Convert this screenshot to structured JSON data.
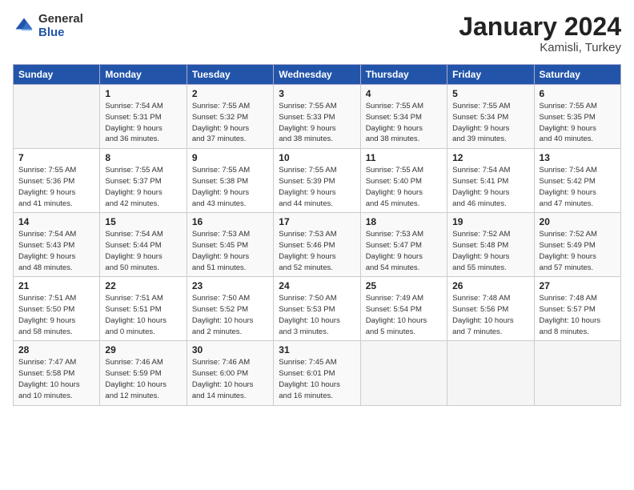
{
  "logo": {
    "general": "General",
    "blue": "Blue"
  },
  "header": {
    "month": "January 2024",
    "location": "Kamisli, Turkey"
  },
  "weekdays": [
    "Sunday",
    "Monday",
    "Tuesday",
    "Wednesday",
    "Thursday",
    "Friday",
    "Saturday"
  ],
  "weeks": [
    [
      {
        "day": "",
        "info": ""
      },
      {
        "day": "1",
        "info": "Sunrise: 7:54 AM\nSunset: 5:31 PM\nDaylight: 9 hours\nand 36 minutes."
      },
      {
        "day": "2",
        "info": "Sunrise: 7:55 AM\nSunset: 5:32 PM\nDaylight: 9 hours\nand 37 minutes."
      },
      {
        "day": "3",
        "info": "Sunrise: 7:55 AM\nSunset: 5:33 PM\nDaylight: 9 hours\nand 38 minutes."
      },
      {
        "day": "4",
        "info": "Sunrise: 7:55 AM\nSunset: 5:34 PM\nDaylight: 9 hours\nand 38 minutes."
      },
      {
        "day": "5",
        "info": "Sunrise: 7:55 AM\nSunset: 5:34 PM\nDaylight: 9 hours\nand 39 minutes."
      },
      {
        "day": "6",
        "info": "Sunrise: 7:55 AM\nSunset: 5:35 PM\nDaylight: 9 hours\nand 40 minutes."
      }
    ],
    [
      {
        "day": "7",
        "info": "Sunrise: 7:55 AM\nSunset: 5:36 PM\nDaylight: 9 hours\nand 41 minutes."
      },
      {
        "day": "8",
        "info": "Sunrise: 7:55 AM\nSunset: 5:37 PM\nDaylight: 9 hours\nand 42 minutes."
      },
      {
        "day": "9",
        "info": "Sunrise: 7:55 AM\nSunset: 5:38 PM\nDaylight: 9 hours\nand 43 minutes."
      },
      {
        "day": "10",
        "info": "Sunrise: 7:55 AM\nSunset: 5:39 PM\nDaylight: 9 hours\nand 44 minutes."
      },
      {
        "day": "11",
        "info": "Sunrise: 7:55 AM\nSunset: 5:40 PM\nDaylight: 9 hours\nand 45 minutes."
      },
      {
        "day": "12",
        "info": "Sunrise: 7:54 AM\nSunset: 5:41 PM\nDaylight: 9 hours\nand 46 minutes."
      },
      {
        "day": "13",
        "info": "Sunrise: 7:54 AM\nSunset: 5:42 PM\nDaylight: 9 hours\nand 47 minutes."
      }
    ],
    [
      {
        "day": "14",
        "info": "Sunrise: 7:54 AM\nSunset: 5:43 PM\nDaylight: 9 hours\nand 48 minutes."
      },
      {
        "day": "15",
        "info": "Sunrise: 7:54 AM\nSunset: 5:44 PM\nDaylight: 9 hours\nand 50 minutes."
      },
      {
        "day": "16",
        "info": "Sunrise: 7:53 AM\nSunset: 5:45 PM\nDaylight: 9 hours\nand 51 minutes."
      },
      {
        "day": "17",
        "info": "Sunrise: 7:53 AM\nSunset: 5:46 PM\nDaylight: 9 hours\nand 52 minutes."
      },
      {
        "day": "18",
        "info": "Sunrise: 7:53 AM\nSunset: 5:47 PM\nDaylight: 9 hours\nand 54 minutes."
      },
      {
        "day": "19",
        "info": "Sunrise: 7:52 AM\nSunset: 5:48 PM\nDaylight: 9 hours\nand 55 minutes."
      },
      {
        "day": "20",
        "info": "Sunrise: 7:52 AM\nSunset: 5:49 PM\nDaylight: 9 hours\nand 57 minutes."
      }
    ],
    [
      {
        "day": "21",
        "info": "Sunrise: 7:51 AM\nSunset: 5:50 PM\nDaylight: 9 hours\nand 58 minutes."
      },
      {
        "day": "22",
        "info": "Sunrise: 7:51 AM\nSunset: 5:51 PM\nDaylight: 10 hours\nand 0 minutes."
      },
      {
        "day": "23",
        "info": "Sunrise: 7:50 AM\nSunset: 5:52 PM\nDaylight: 10 hours\nand 2 minutes."
      },
      {
        "day": "24",
        "info": "Sunrise: 7:50 AM\nSunset: 5:53 PM\nDaylight: 10 hours\nand 3 minutes."
      },
      {
        "day": "25",
        "info": "Sunrise: 7:49 AM\nSunset: 5:54 PM\nDaylight: 10 hours\nand 5 minutes."
      },
      {
        "day": "26",
        "info": "Sunrise: 7:48 AM\nSunset: 5:56 PM\nDaylight: 10 hours\nand 7 minutes."
      },
      {
        "day": "27",
        "info": "Sunrise: 7:48 AM\nSunset: 5:57 PM\nDaylight: 10 hours\nand 8 minutes."
      }
    ],
    [
      {
        "day": "28",
        "info": "Sunrise: 7:47 AM\nSunset: 5:58 PM\nDaylight: 10 hours\nand 10 minutes."
      },
      {
        "day": "29",
        "info": "Sunrise: 7:46 AM\nSunset: 5:59 PM\nDaylight: 10 hours\nand 12 minutes."
      },
      {
        "day": "30",
        "info": "Sunrise: 7:46 AM\nSunset: 6:00 PM\nDaylight: 10 hours\nand 14 minutes."
      },
      {
        "day": "31",
        "info": "Sunrise: 7:45 AM\nSunset: 6:01 PM\nDaylight: 10 hours\nand 16 minutes."
      },
      {
        "day": "",
        "info": ""
      },
      {
        "day": "",
        "info": ""
      },
      {
        "day": "",
        "info": ""
      }
    ]
  ]
}
